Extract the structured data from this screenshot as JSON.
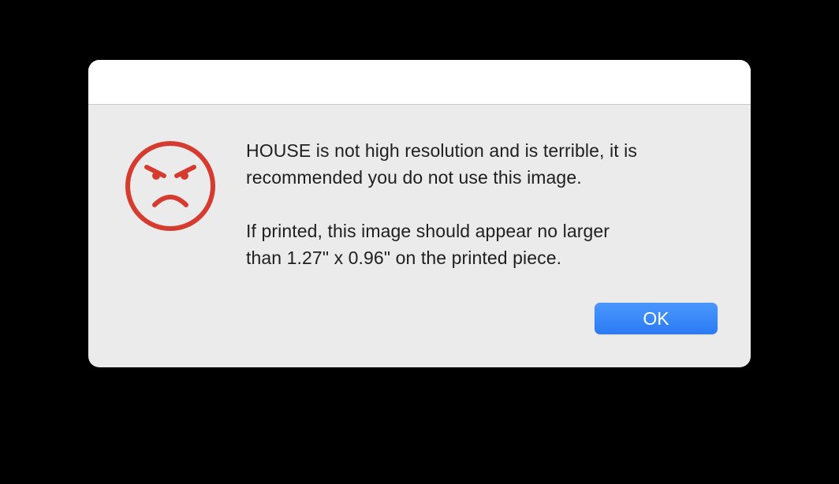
{
  "dialog": {
    "icon": "angry-face-icon",
    "accent_color": "#d63b2f",
    "message_primary": "HOUSE is not high resolution and is terrible, it is\nrecommended you do not use this image.",
    "message_secondary": "If printed, this image should appear no larger\nthan 1.27\" x 0.96\" on the printed piece.",
    "ok_label": "OK",
    "ok_color": "#2f80f6"
  }
}
